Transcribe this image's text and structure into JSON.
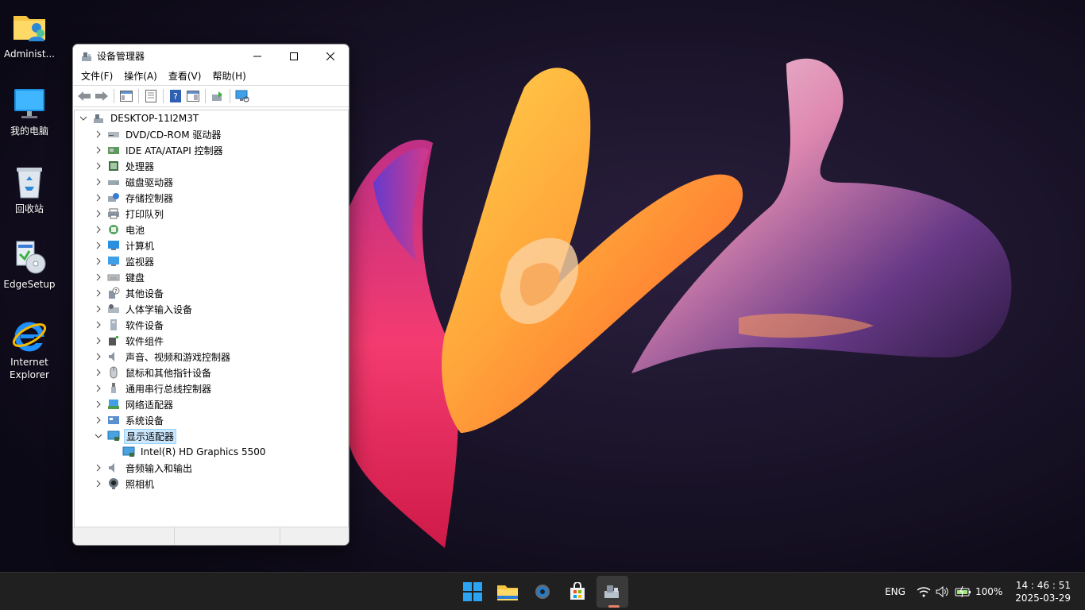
{
  "desktop": {
    "icons": [
      {
        "label": "Administ..."
      },
      {
        "label": "我的电脑"
      },
      {
        "label": "回收站"
      },
      {
        "label": "EdgeSetup"
      },
      {
        "label": "Internet\nExplorer"
      }
    ]
  },
  "window": {
    "title": "设备管理器",
    "menu": [
      "文件(F)",
      "操作(A)",
      "查看(V)",
      "帮助(H)"
    ],
    "tree": {
      "root": "DESKTOP-11I2M3T",
      "categories": [
        {
          "label": "DVD/CD-ROM 驱动器",
          "icon": "dvd-drive-icon"
        },
        {
          "label": "IDE ATA/ATAPI 控制器",
          "icon": "ide-controller-icon"
        },
        {
          "label": "处理器",
          "icon": "processor-icon"
        },
        {
          "label": "磁盘驱动器",
          "icon": "disk-drive-icon"
        },
        {
          "label": "存储控制器",
          "icon": "storage-controller-icon"
        },
        {
          "label": "打印队列",
          "icon": "printer-icon"
        },
        {
          "label": "电池",
          "icon": "battery-icon"
        },
        {
          "label": "计算机",
          "icon": "computer-icon"
        },
        {
          "label": "监视器",
          "icon": "monitor-icon"
        },
        {
          "label": "键盘",
          "icon": "keyboard-icon"
        },
        {
          "label": "其他设备",
          "icon": "unknown-device-icon"
        },
        {
          "label": "人体学输入设备",
          "icon": "hid-icon"
        },
        {
          "label": "软件设备",
          "icon": "software-device-icon"
        },
        {
          "label": "软件组件",
          "icon": "software-component-icon"
        },
        {
          "label": "声音、视频和游戏控制器",
          "icon": "sound-icon"
        },
        {
          "label": "鼠标和其他指针设备",
          "icon": "mouse-icon"
        },
        {
          "label": "通用串行总线控制器",
          "icon": "usb-icon"
        },
        {
          "label": "网络适配器",
          "icon": "network-adapter-icon"
        },
        {
          "label": "系统设备",
          "icon": "system-device-icon"
        },
        {
          "label": "显示适配器",
          "icon": "display-adapter-icon",
          "expanded": true,
          "selected": true,
          "children": [
            {
              "label": "Intel(R) HD Graphics 5500",
              "icon": "display-adapter-icon"
            }
          ]
        },
        {
          "label": "音频输入和输出",
          "icon": "audio-io-icon"
        },
        {
          "label": "照相机",
          "icon": "camera-icon"
        }
      ]
    }
  },
  "taskbar": {
    "language": "ENG",
    "battery": "100%",
    "time": "14 : 46 : 51",
    "date": "2025-03-29"
  }
}
